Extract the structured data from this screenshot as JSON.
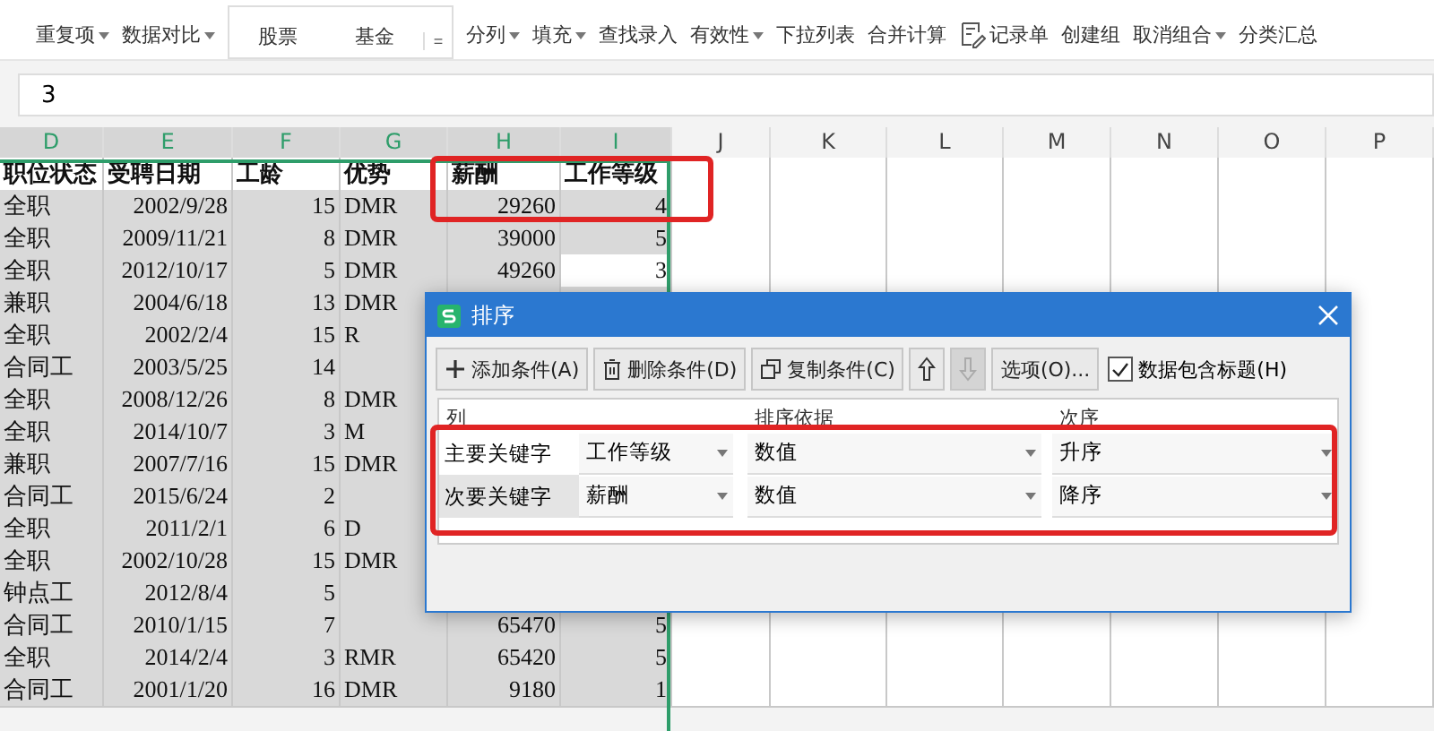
{
  "ribbon": {
    "items": [
      {
        "kind": "menu",
        "label": "重复项"
      },
      {
        "kind": "menu",
        "label": "数据对比"
      },
      {
        "kind": "gallery",
        "label": "股票"
      },
      {
        "kind": "gallery",
        "label": "基金"
      },
      {
        "kind": "more",
        "label": "="
      },
      {
        "kind": "menu",
        "label": "分列"
      },
      {
        "kind": "menu",
        "label": "填充"
      },
      {
        "kind": "plain",
        "label": "查找录入"
      },
      {
        "kind": "menu",
        "label": "有效性"
      },
      {
        "kind": "plain",
        "label": "下拉列表"
      },
      {
        "kind": "plain",
        "label": "合并计算"
      },
      {
        "kind": "icon",
        "label": "记录单"
      },
      {
        "kind": "plain",
        "label": "创建组"
      },
      {
        "kind": "menu",
        "label": "取消组合"
      },
      {
        "kind": "plain",
        "label": "分类汇总"
      }
    ]
  },
  "formula_bar": {
    "value": "3"
  },
  "sheet": {
    "columns": [
      {
        "label": "D",
        "selected": true
      },
      {
        "label": "E",
        "selected": true
      },
      {
        "label": "F",
        "selected": true
      },
      {
        "label": "G",
        "selected": true
      },
      {
        "label": "H",
        "selected": true
      },
      {
        "label": "I",
        "selected": true
      },
      {
        "label": "J",
        "selected": false
      },
      {
        "label": "K",
        "selected": false
      },
      {
        "label": "L",
        "selected": false
      },
      {
        "label": "M",
        "selected": false
      },
      {
        "label": "N",
        "selected": false
      },
      {
        "label": "O",
        "selected": false
      },
      {
        "label": "P",
        "selected": false
      }
    ],
    "header": [
      "职位状态",
      "受聘日期",
      "工龄",
      "优势",
      "薪酬",
      "工作等级"
    ],
    "rows": [
      {
        "cells": [
          "全职",
          "2002/9/28",
          "15",
          "DMR",
          "29260",
          "4"
        ],
        "active": false
      },
      {
        "cells": [
          "全职",
          "2009/11/21",
          "8",
          "DMR",
          "39000",
          "5"
        ],
        "active": false
      },
      {
        "cells": [
          "全职",
          "2012/10/17",
          "5",
          "DMR",
          "49260",
          "3"
        ],
        "active": true
      },
      {
        "cells": [
          "兼职",
          "2004/6/18",
          "13",
          "DMR"
        ]
      },
      {
        "cells": [
          "全职",
          "2002/2/4",
          "15",
          "R"
        ]
      },
      {
        "cells": [
          "合同工",
          "2003/5/25",
          "14"
        ]
      },
      {
        "cells": [
          "全职",
          "2008/12/26",
          "8",
          "DMR"
        ]
      },
      {
        "cells": [
          "全职",
          "2014/10/7",
          "3",
          "M"
        ]
      },
      {
        "cells": [
          "兼职",
          "2007/7/16",
          "15",
          "DMR"
        ]
      },
      {
        "cells": [
          "合同工",
          "2015/6/24",
          "2"
        ]
      },
      {
        "cells": [
          "全职",
          "2011/2/1",
          "6",
          "D"
        ]
      },
      {
        "cells": [
          "全职",
          "2002/10/28",
          "15",
          "DMR"
        ]
      },
      {
        "cells": [
          "钟点工",
          "2012/8/4",
          "5"
        ]
      },
      {
        "cells": [
          "合同工",
          "2010/1/15",
          "7",
          "",
          "65470",
          "5"
        ],
        "active": false
      },
      {
        "cells": [
          "全职",
          "2014/2/4",
          "3",
          "RMR",
          "65420",
          "5"
        ],
        "active": false
      },
      {
        "cells": [
          "合同工",
          "2001/1/20",
          "16",
          "DMR",
          "9180",
          "1"
        ],
        "active": false
      }
    ]
  },
  "sort_dialog": {
    "title": "排序",
    "toolbar": [
      {
        "kind": "add",
        "label": "添加条件(A)",
        "disabled": false
      },
      {
        "kind": "delete",
        "label": "删除条件(D)",
        "disabled": false
      },
      {
        "kind": "copy",
        "label": "复制条件(C)",
        "disabled": false
      },
      {
        "kind": "up",
        "disabled": false
      },
      {
        "kind": "down",
        "disabled": true
      },
      {
        "kind": "text",
        "label": "选项(O)...",
        "disabled": false
      }
    ],
    "header_checkbox": {
      "label": "数据包含标题(H)",
      "checked": true
    },
    "columns": [
      "列",
      "排序依据",
      "次序"
    ],
    "rows": [
      {
        "label": "主要关键字",
        "key": "工作等级",
        "basis": "数值",
        "order": "升序",
        "selected": false
      },
      {
        "label": "次要关键字",
        "key": "薪酬",
        "basis": "数值",
        "order": "降序",
        "selected": true
      }
    ]
  }
}
